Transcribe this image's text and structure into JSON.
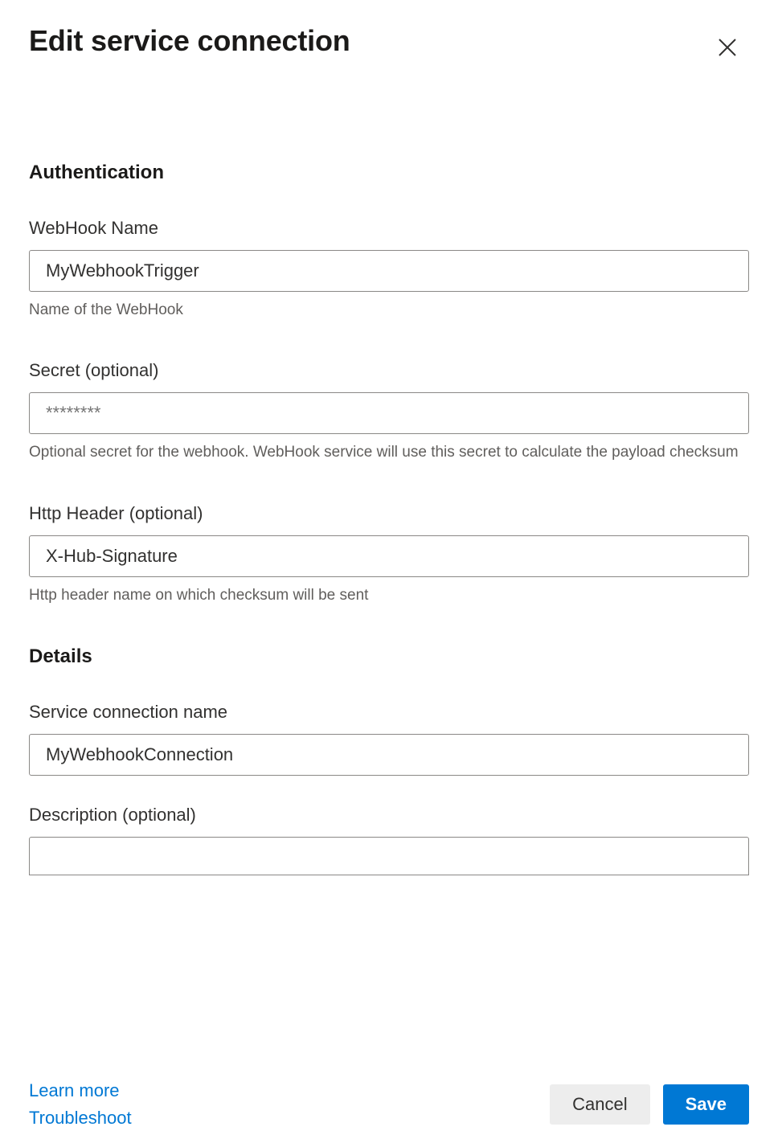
{
  "header": {
    "title": "Edit service connection"
  },
  "authentication": {
    "heading": "Authentication",
    "webhookName": {
      "label": "WebHook Name",
      "value": "MyWebhookTrigger",
      "help": "Name of the WebHook"
    },
    "secret": {
      "label": "Secret (optional)",
      "placeholder": "********",
      "help": "Optional secret for the webhook. WebHook service will use this secret to calculate the payload checksum"
    },
    "httpHeader": {
      "label": "Http Header (optional)",
      "value": "X-Hub-Signature",
      "help": "Http header name on which checksum will be sent"
    }
  },
  "details": {
    "heading": "Details",
    "serviceConnectionName": {
      "label": "Service connection name",
      "value": "MyWebhookConnection"
    },
    "description": {
      "label": "Description (optional)",
      "value": ""
    }
  },
  "footer": {
    "learnMore": "Learn more",
    "troubleshoot": "Troubleshoot",
    "cancel": "Cancel",
    "save": "Save"
  }
}
